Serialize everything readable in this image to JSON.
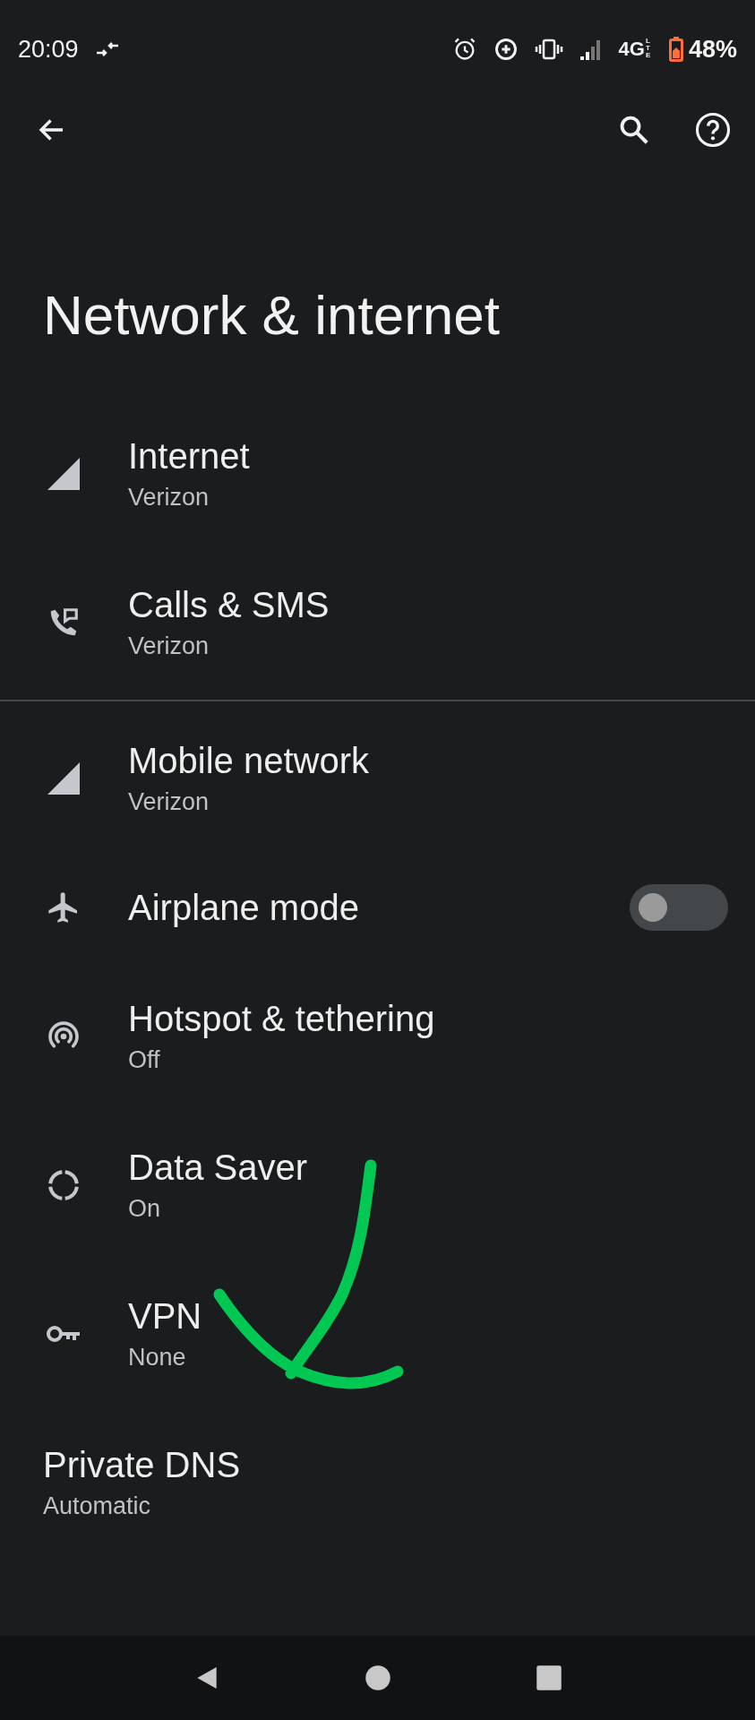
{
  "status_bar": {
    "time": "20:09",
    "network": "4G",
    "network_sub": "LTE",
    "battery": "48%"
  },
  "title": "Network & internet",
  "groups": [
    {
      "items": [
        {
          "kind": "link",
          "title": "Internet",
          "subtitle": "Verizon"
        },
        {
          "kind": "link",
          "title": "Calls & SMS",
          "subtitle": "Verizon"
        }
      ]
    },
    {
      "items": [
        {
          "kind": "link",
          "title": "Mobile network",
          "subtitle": "Verizon"
        },
        {
          "kind": "toggle",
          "title": "Airplane mode",
          "on": false
        },
        {
          "kind": "link",
          "title": "Hotspot & tethering",
          "subtitle": "Off"
        },
        {
          "kind": "link",
          "title": "Data Saver",
          "subtitle": "On"
        },
        {
          "kind": "link",
          "title": "VPN",
          "subtitle": "None"
        },
        {
          "kind": "link",
          "title": "Private DNS",
          "subtitle": "Automatic"
        }
      ]
    }
  ]
}
